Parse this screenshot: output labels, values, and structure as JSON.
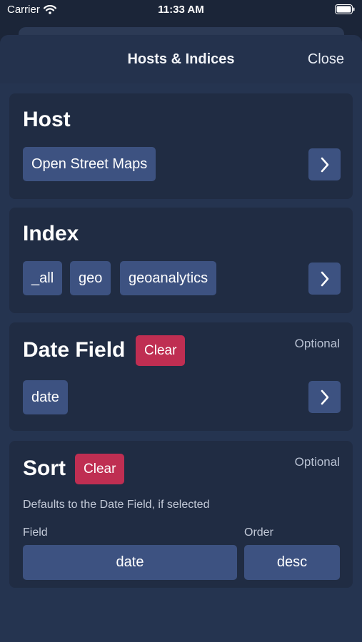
{
  "status_bar": {
    "carrier": "Carrier",
    "time": "11:33 AM"
  },
  "nav": {
    "title": "Hosts & Indices",
    "close_label": "Close"
  },
  "host": {
    "title": "Host",
    "selected": "Open Street Maps"
  },
  "index": {
    "title": "Index",
    "chips": [
      "_all",
      "geo",
      "geoanalytics"
    ]
  },
  "date_field": {
    "title": "Date Field",
    "clear_label": "Clear",
    "optional_label": "Optional",
    "selected": "date"
  },
  "sort": {
    "title": "Sort",
    "clear_label": "Clear",
    "optional_label": "Optional",
    "hint": "Defaults to the Date Field, if selected",
    "field_label": "Field",
    "order_label": "Order",
    "field_value": "date",
    "order_value": "desc"
  },
  "colors": {
    "background": "#1b2538",
    "sheet": "#253450",
    "card": "#202c43",
    "chip": "#3d5281",
    "clear": "#bf2e52"
  },
  "icons": [
    "wifi-icon",
    "battery-icon",
    "chevron-right-icon"
  ]
}
